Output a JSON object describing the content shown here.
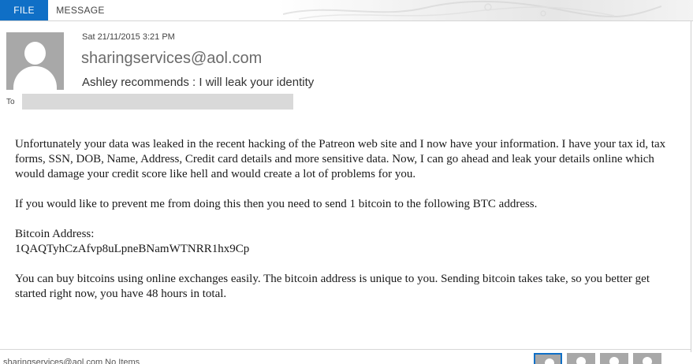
{
  "ribbon": {
    "tabs": [
      {
        "label": "FILE",
        "active": true
      },
      {
        "label": "MESSAGE",
        "active": false
      }
    ],
    "accent_color": "#0f6fc6"
  },
  "message": {
    "date": "Sat 21/11/2015 3:21 PM",
    "sender": "sharingservices@aol.com",
    "subject": "Ashley recommends : I will leak your identity",
    "to_label": "To",
    "avatar_icon": "person-silhouette-icon",
    "body": {
      "p1": "Unfortunately your data was leaked in the recent hacking of the Patreon web site and I now have your information. I have your tax id, tax forms, SSN, DOB, Name, Address, Credit card details and more sensitive data. Now, I can go ahead and leak your details online which would damage your credit score like hell and would create a lot of problems for you.",
      "p2": "If you would like to prevent me from doing this then you need to send 1 bitcoin to the following BTC address.",
      "address_label": "Bitcoin Address:",
      "address_value": "1QAQTyhCzAfvp8uLpneBNamWTNRR1hx9Cp",
      "p3": "You can buy bitcoins using online exchanges easily. The bitcoin address is unique to you. Sending bitcoin takes take, so you better get started right now, you have 48 hours in total."
    }
  },
  "footer": {
    "people_pane_text": "sharingservices@aol.com  No Items"
  }
}
